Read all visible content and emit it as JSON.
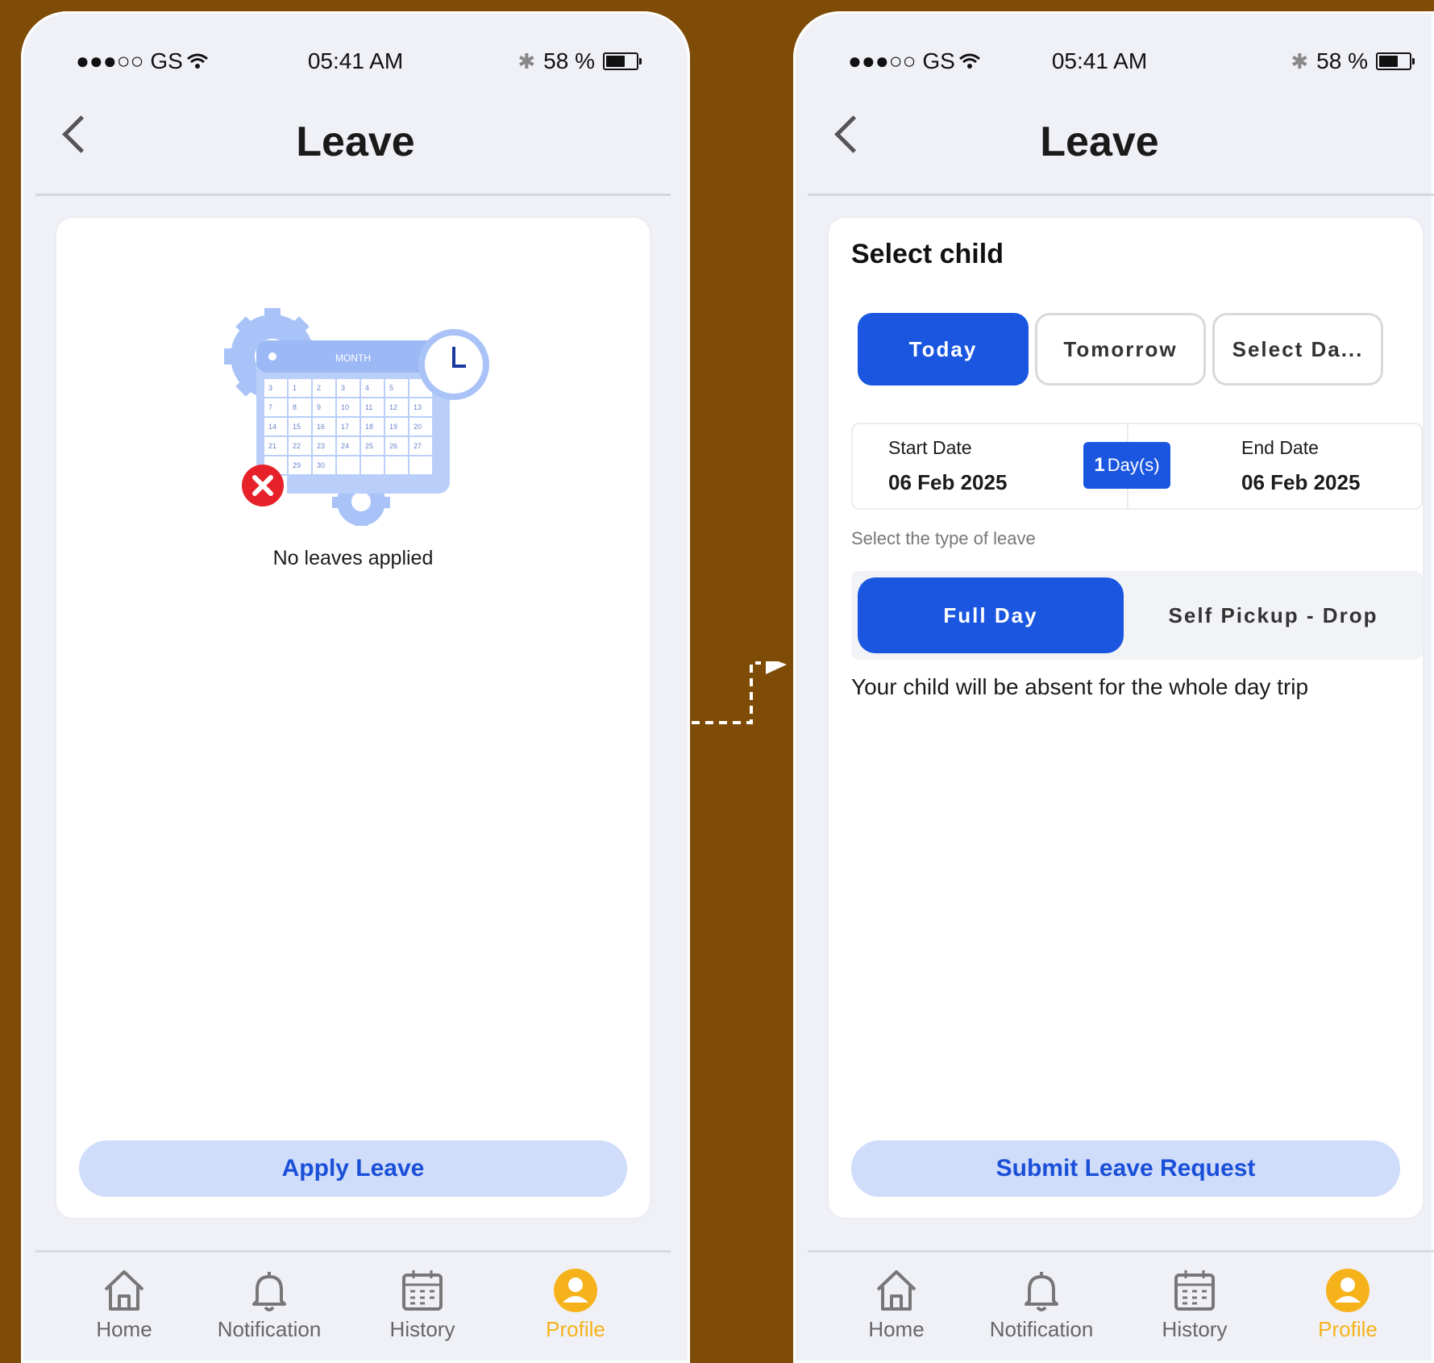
{
  "status_bar": {
    "carrier": "●●●○○ GS",
    "time": "05:41 AM",
    "battery": "58 %"
  },
  "screen_empty": {
    "title": "Leave",
    "empty_text": "No leaves applied",
    "illustration_month": "MONTH",
    "calendar_days": [
      "3",
      "1",
      "2",
      "3",
      "4",
      "5",
      "",
      "7",
      "8",
      "9",
      "10",
      "11",
      "12",
      "13",
      "14",
      "15",
      "16",
      "17",
      "18",
      "19",
      "20",
      "21",
      "22",
      "23",
      "24",
      "25",
      "26",
      "27",
      "",
      "29",
      "30",
      "",
      "",
      "",
      "",
      ""
    ],
    "apply_button": "Apply Leave"
  },
  "screen_form": {
    "title": "Leave",
    "section_title": "Select child",
    "day_tabs": [
      {
        "label": "Today",
        "active": true
      },
      {
        "label": "Tomorrow",
        "active": false
      },
      {
        "label": "Select Da...",
        "active": false
      }
    ],
    "start_label": "Start Date",
    "start_value": "06 Feb 2025",
    "end_label": "End Date",
    "end_value": "06 Feb 2025",
    "day_count": "1",
    "day_unit": "Day(s)",
    "leave_type_label": "Select the type of leave",
    "leave_types": [
      "Full Day",
      "Self Pickup - Drop"
    ],
    "description": "Your child will be absent for the whole day trip",
    "submit_button": "Submit Leave Request"
  },
  "tabbar": {
    "items": [
      "Home",
      "Notification",
      "History",
      "Profile"
    ],
    "active": "Profile"
  },
  "colors": {
    "background": "#7e4c06",
    "primary": "#1a56e0",
    "primary_light": "#cfdcfa",
    "active_tab": "#f6b21a"
  }
}
